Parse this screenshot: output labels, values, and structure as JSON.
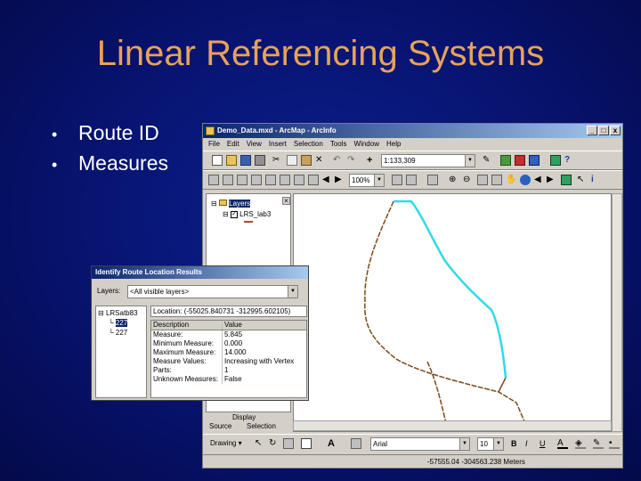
{
  "slide": {
    "title": "Linear Referencing Systems",
    "bullets": [
      "Route ID",
      "Measures"
    ]
  },
  "window": {
    "title": "Demo_Data.mxd - ArcMap - ArcInfo",
    "controls": [
      "_",
      "□",
      "x"
    ],
    "menu": [
      "File",
      "Edit",
      "View",
      "Insert",
      "Selection",
      "Tools",
      "Window",
      "Help"
    ],
    "scale": "1:133,309",
    "zoom": "100%",
    "toc": {
      "root": "Layers",
      "layer": "LRS_lab3"
    },
    "toc_tabs": [
      "Display",
      "Source",
      "Selection"
    ],
    "drawing_label": "Drawing",
    "font_name": "Arial",
    "font_size": "10",
    "status": "-57555.04  -304563.238 Meters"
  },
  "identify": {
    "title": "Identify Route Location Results",
    "layers_label": "Layers:",
    "layers_value": "<All visible layers>",
    "tree": {
      "root": "LRSatb83",
      "children": [
        "227",
        "227"
      ]
    },
    "location": "Location: (-55025.840731  -312995.602105)",
    "columns": [
      "Description",
      "Value"
    ],
    "rows": [
      [
        "Measure:",
        "5.845"
      ],
      [
        "Minimum Measure:",
        "0.000"
      ],
      [
        "Maximum Measure:",
        "14.000"
      ],
      [
        "Measure Values:",
        "Increasing with Vertex"
      ],
      [
        "Parts:",
        "1"
      ],
      [
        "Unknown Measures:",
        "False"
      ]
    ]
  },
  "colors": {
    "slide_bg": "#07136e",
    "title": "#e8a25a",
    "route_highlight": "#31d9e8",
    "road": "#7a4a1a"
  }
}
